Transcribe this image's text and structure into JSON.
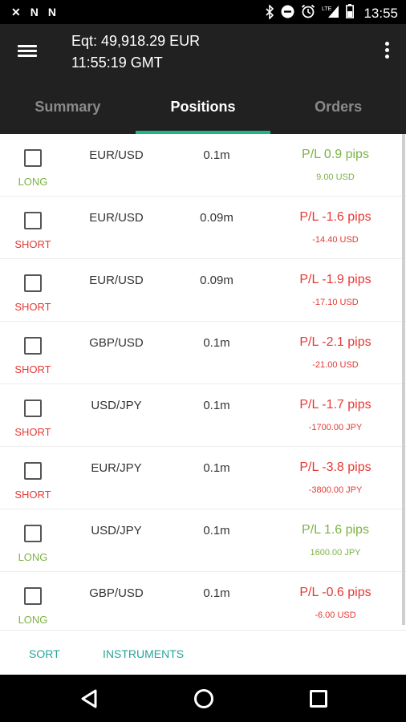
{
  "status": {
    "time": "13:55",
    "left_icons": [
      "notification-x-icon",
      "n-app-icon",
      "n-app-icon"
    ],
    "right_icons": [
      "bluetooth-icon",
      "do-not-disturb-icon",
      "alarm-icon",
      "lte-signal-icon",
      "battery-icon"
    ],
    "lte_label": "LTE"
  },
  "appbar": {
    "equity": "Eqt: 49,918.29 EUR",
    "time": "11:55:19 GMT"
  },
  "tabs": [
    "Summary",
    "Positions",
    "Orders"
  ],
  "active_tab": 1,
  "colors": {
    "accent": "#1fb58b",
    "long": "#7cb342",
    "short": "#e53935",
    "action": "#26a69a"
  },
  "positions": [
    {
      "side": "LONG",
      "pair": "EUR/USD",
      "amount": "0.1m",
      "pl": "P/L 0.9 pips",
      "pl_value": "9.00 USD",
      "color": "green"
    },
    {
      "side": "SHORT",
      "pair": "EUR/USD",
      "amount": "0.09m",
      "pl": "P/L -1.6 pips",
      "pl_value": "-14.40 USD",
      "color": "red"
    },
    {
      "side": "SHORT",
      "pair": "EUR/USD",
      "amount": "0.09m",
      "pl": "P/L -1.9 pips",
      "pl_value": "-17.10 USD",
      "color": "red"
    },
    {
      "side": "SHORT",
      "pair": "GBP/USD",
      "amount": "0.1m",
      "pl": "P/L -2.1 pips",
      "pl_value": "-21.00 USD",
      "color": "red"
    },
    {
      "side": "SHORT",
      "pair": "USD/JPY",
      "amount": "0.1m",
      "pl": "P/L -1.7 pips",
      "pl_value": "-1700.00 JPY",
      "color": "red"
    },
    {
      "side": "SHORT",
      "pair": "EUR/JPY",
      "amount": "0.1m",
      "pl": "P/L -3.8 pips",
      "pl_value": "-3800.00 JPY",
      "color": "red"
    },
    {
      "side": "LONG",
      "pair": "USD/JPY",
      "amount": "0.1m",
      "pl": "P/L 1.6 pips",
      "pl_value": "1600.00 JPY",
      "color": "green"
    },
    {
      "side": "LONG",
      "pair": "GBP/USD",
      "amount": "0.1m",
      "pl": "P/L -0.6 pips",
      "pl_value": "-6.00 USD",
      "color": "red"
    }
  ],
  "actions": {
    "sort": "SORT",
    "instruments": "INSTRUMENTS"
  }
}
